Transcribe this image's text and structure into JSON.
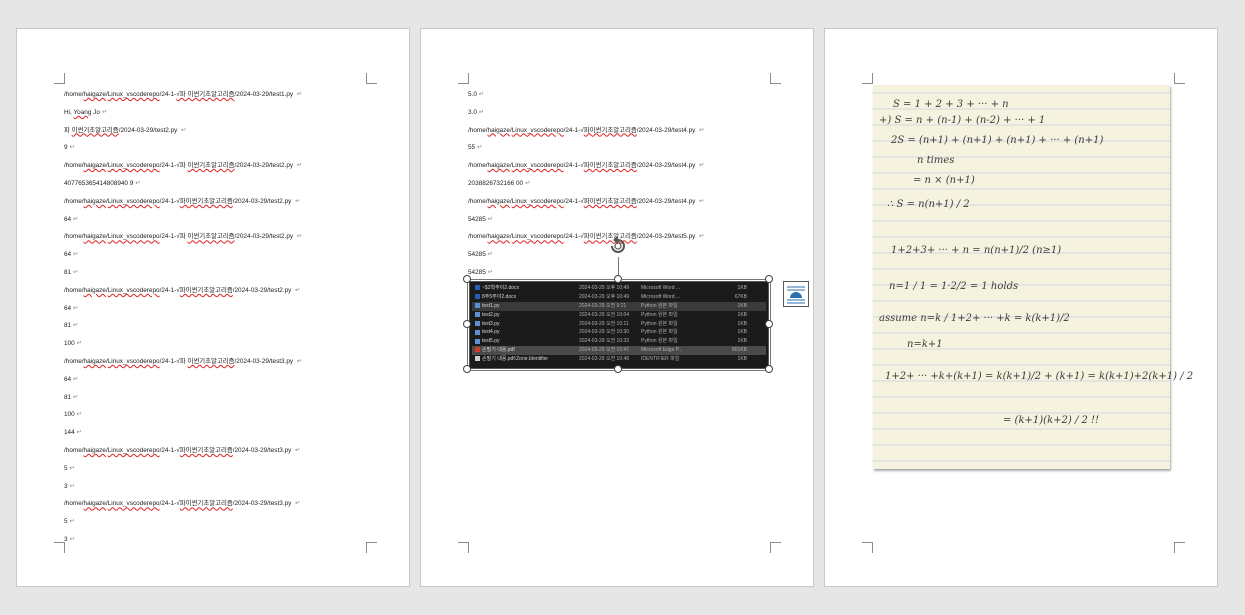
{
  "page1": {
    "lines": [
      {
        "parts": [
          {
            "t": "/home/"
          },
          {
            "t": "haigaze",
            "s": 1
          },
          {
            "t": "/"
          },
          {
            "t": "Linux_vscoderepo",
            "s": 1
          },
          {
            "t": "/24-1-"
          },
          {
            "t": "√파 이썬기초알고리즘",
            "s": 1
          },
          {
            "t": "/2024-03-29/test1.py "
          }
        ],
        "mark": "↵"
      },
      {
        "parts": [
          {
            "t": "Hi, "
          },
          {
            "t": "Yoang",
            "s": 1
          },
          {
            "t": " Jo"
          }
        ],
        "mark": "↵"
      },
      {
        "parts": [
          {
            "t": "파 "
          },
          {
            "t": "이썬기초알고리즘",
            "s": 1
          },
          {
            "t": "/2024-03-29/test2.py "
          }
        ],
        "mark": "↵"
      },
      {
        "parts": [
          {
            "t": "9"
          }
        ],
        "mark": "↵"
      },
      {
        "parts": [
          {
            "t": "/home/"
          },
          {
            "t": "haigaze",
            "s": 1
          },
          {
            "t": "/"
          },
          {
            "t": "Linux_vscoderepo",
            "s": 1
          },
          {
            "t": "/24-1-√파 "
          },
          {
            "t": "이썬기초알고리즘",
            "s": 1
          },
          {
            "t": "/2024-03-29/test2.py "
          }
        ],
        "mark": "↵"
      },
      {
        "parts": [
          {
            "t": "407765365414808940 9"
          }
        ],
        "mark": "↵"
      },
      {
        "parts": [
          {
            "t": "/home/"
          },
          {
            "t": "haigaze",
            "s": 1
          },
          {
            "t": "/"
          },
          {
            "t": "Linux_vscoderepo",
            "s": 1
          },
          {
            "t": "/24-1-√"
          },
          {
            "t": "파이썬기초알고리즘",
            "s": 1
          },
          {
            "t": "/2024-03-29/test2.py "
          }
        ],
        "mark": "↵"
      },
      {
        "parts": [
          {
            "t": "64"
          }
        ],
        "mark": "↵"
      },
      {
        "parts": [
          {
            "t": "/home/"
          },
          {
            "t": "haigaze",
            "s": 1
          },
          {
            "t": "/"
          },
          {
            "t": "Linux_vscoderepo",
            "s": 1
          },
          {
            "t": "/24-1-√파 "
          },
          {
            "t": "이썬기초알고리즘",
            "s": 1
          },
          {
            "t": "/2024-03-29/test2.py "
          }
        ],
        "mark": "↵"
      },
      {
        "parts": [
          {
            "t": "64"
          }
        ],
        "mark": "↵"
      },
      {
        "parts": [
          {
            "t": "81"
          }
        ],
        "mark": "↵"
      },
      {
        "parts": [
          {
            "t": "/home/"
          },
          {
            "t": "haigaze",
            "s": 1
          },
          {
            "t": "/"
          },
          {
            "t": "Linux_vscoderepo",
            "s": 1
          },
          {
            "t": "/24-1-√"
          },
          {
            "t": "파이썬기초알고리즘",
            "s": 1
          },
          {
            "t": "/2024-03-29/test2.py "
          }
        ],
        "mark": "↵"
      },
      {
        "parts": [
          {
            "t": "64"
          }
        ],
        "mark": "↵"
      },
      {
        "parts": [
          {
            "t": "81"
          }
        ],
        "mark": "↵"
      },
      {
        "parts": [
          {
            "t": "100"
          }
        ],
        "mark": "↵"
      },
      {
        "parts": [
          {
            "t": "/home/"
          },
          {
            "t": "haigaze",
            "s": 1
          },
          {
            "t": "/"
          },
          {
            "t": "Linux_vscoderepo",
            "s": 1
          },
          {
            "t": "/24-1-√파 "
          },
          {
            "t": "이썬기초알고리즘",
            "s": 1
          },
          {
            "t": "/2024-03-29/test3.py "
          }
        ],
        "mark": "↵"
      },
      {
        "parts": [
          {
            "t": "64"
          }
        ],
        "mark": "↵"
      },
      {
        "parts": [
          {
            "t": "81"
          }
        ],
        "mark": "↵"
      },
      {
        "parts": [
          {
            "t": "100"
          }
        ],
        "mark": "↵"
      },
      {
        "parts": [
          {
            "t": "144"
          }
        ],
        "mark": "↵"
      },
      {
        "parts": [
          {
            "t": "/home/"
          },
          {
            "t": "haigaze",
            "s": 1
          },
          {
            "t": "/"
          },
          {
            "t": "Linux_vscoderepo",
            "s": 1
          },
          {
            "t": "/24-1-√"
          },
          {
            "t": "파이썬기초알고리즘",
            "s": 1
          },
          {
            "t": "/2024-03-29/test3.py "
          }
        ],
        "mark": "↵"
      },
      {
        "parts": [
          {
            "t": "5"
          }
        ],
        "mark": "↵"
      },
      {
        "parts": [
          {
            "t": "3"
          }
        ],
        "mark": "↵"
      },
      {
        "parts": [
          {
            "t": "/home/"
          },
          {
            "t": "haigaze",
            "s": 1
          },
          {
            "t": "/"
          },
          {
            "t": "Linux_vscoderepo",
            "s": 1
          },
          {
            "t": "/24-1-√"
          },
          {
            "t": "파이썬기초알고리즘",
            "s": 1
          },
          {
            "t": "/2024-03-29/test3.py "
          }
        ],
        "mark": "↵"
      },
      {
        "parts": [
          {
            "t": "5"
          }
        ],
        "mark": "↵"
      },
      {
        "parts": [
          {
            "t": "3"
          }
        ],
        "mark": "↵"
      }
    ]
  },
  "page2": {
    "lines": [
      {
        "parts": [
          {
            "t": "5.0"
          }
        ],
        "mark": "↵"
      },
      {
        "parts": [
          {
            "t": "3.0"
          }
        ],
        "mark": "↵"
      },
      {
        "parts": [
          {
            "t": "/home/"
          },
          {
            "t": "haigaze",
            "s": 1
          },
          {
            "t": "/"
          },
          {
            "t": "Linux_vscoderepo",
            "s": 1
          },
          {
            "t": "/24-1-√"
          },
          {
            "t": "파이썬기초알고리즘",
            "s": 1
          },
          {
            "t": "/2024-03-29/test4.py "
          }
        ],
        "mark": "↵"
      },
      {
        "parts": [
          {
            "t": "55"
          }
        ],
        "mark": "↵"
      },
      {
        "parts": [
          {
            "t": "/home/"
          },
          {
            "t": "haigaze",
            "s": 1
          },
          {
            "t": "/"
          },
          {
            "t": "Linux_vscoderepo",
            "s": 1
          },
          {
            "t": "/24-1-√"
          },
          {
            "t": "파이썬기초알고리즘",
            "s": 1
          },
          {
            "t": "/2024-03-29/test4.py "
          }
        ],
        "mark": "↵"
      },
      {
        "parts": [
          {
            "t": "2038826732166 00"
          }
        ],
        "mark": "↵"
      },
      {
        "parts": [
          {
            "t": "/home/"
          },
          {
            "t": "haigaze",
            "s": 1
          },
          {
            "t": "/"
          },
          {
            "t": "Linux_vscoderepo",
            "s": 1
          },
          {
            "t": "/24-1-√"
          },
          {
            "t": "파이썬기초알고리즘",
            "s": 1
          },
          {
            "t": "/2024-03-29/test4.py "
          }
        ],
        "mark": "↵"
      },
      {
        "parts": [
          {
            "t": "54285"
          }
        ],
        "mark": "↵"
      },
      {
        "parts": [
          {
            "t": "/home/"
          },
          {
            "t": "haigaze",
            "s": 1
          },
          {
            "t": "/"
          },
          {
            "t": "Linux_vscoderepo",
            "s": 1
          },
          {
            "t": "/24-1-√"
          },
          {
            "t": "파이썬기초알고리즘",
            "s": 1
          },
          {
            "t": "/2024-03-29/test5.py "
          }
        ],
        "mark": "↵"
      },
      {
        "parts": [
          {
            "t": "54285"
          }
        ],
        "mark": "↵"
      },
      {
        "parts": [
          {
            "t": "54285"
          }
        ],
        "mark": "↵"
      }
    ],
    "files": [
      {
        "name": "~$2학주이2.docx",
        "date": "2024-03-29 오후 10:49",
        "type": "Microsoft Word ...",
        "size": "1KB",
        "icon": "word",
        "style": ""
      },
      {
        "name": "8주5주이2.docx",
        "date": "2024-03-29 오후 10:49",
        "type": "Microsoft Word ...",
        "size": "67KB",
        "icon": "word",
        "style": ""
      },
      {
        "name": "test1.py",
        "date": "2024-03-29 오전 9:21",
        "type": "Python 원본 파일",
        "size": "1KB",
        "icon": "py",
        "style": "sel"
      },
      {
        "name": "test2.py",
        "date": "2024-03-29 오전 10:04",
        "type": "Python 원본 파일",
        "size": "1KB",
        "icon": "py",
        "style": ""
      },
      {
        "name": "test3.py",
        "date": "2024-03-29 오전 10:11",
        "type": "Python 원본 파일",
        "size": "1KB",
        "icon": "py",
        "style": ""
      },
      {
        "name": "test4.py",
        "date": "2024-03-29 오전 10:30",
        "type": "Python 원본 파일",
        "size": "1KB",
        "icon": "py",
        "style": ""
      },
      {
        "name": "test5.py",
        "date": "2024-03-29 오전 10:33",
        "type": "Python 원본 파일",
        "size": "1KB",
        "icon": "py",
        "style": ""
      },
      {
        "name": "손필기 내용.pdf",
        "date": "2024-03-29 오전 10:47",
        "type": "Microsoft Edge P...",
        "size": "801KB",
        "icon": "pdf",
        "style": "hi"
      },
      {
        "name": "손필기 내용.pdf:Zone.Identifier",
        "date": "2024-03-29 오전 10:48",
        "type": "IDENTIFIER 파일",
        "size": "1KB",
        "icon": "doc",
        "style": ""
      }
    ]
  },
  "page3": {
    "handwriting": [
      "S = 1 + 2 + 3 + ··· + n",
      "+) S = n + (n-1) + (n-2) + ··· + 1",
      "2S = (n+1) + (n+1) + (n+1) + ··· + (n+1)",
      "n times",
      "= n × (n+1)",
      "∴ S = n(n+1) / 2",
      "1+2+3+ ··· + n = n(n+1)/2   (n≥1)",
      "n=1  /  1 = 1·2/2 = 1   holds",
      "assume n=k  /  1+2+ ··· +k = k(k+1)/2",
      "n=k+1",
      "1+2+ ··· +k+(k+1) = k(k+1)/2 + (k+1) = k(k+1)+2(k+1) / 2",
      "= (k+1)(k+2) / 2  !!"
    ]
  },
  "colors": {
    "page_bg": "#ffffff",
    "canvas_bg": "#e6e6e6",
    "spell_underline": "#e02020",
    "explorer_bg": "#1b1b1b",
    "paper": "#f5f2e0"
  }
}
